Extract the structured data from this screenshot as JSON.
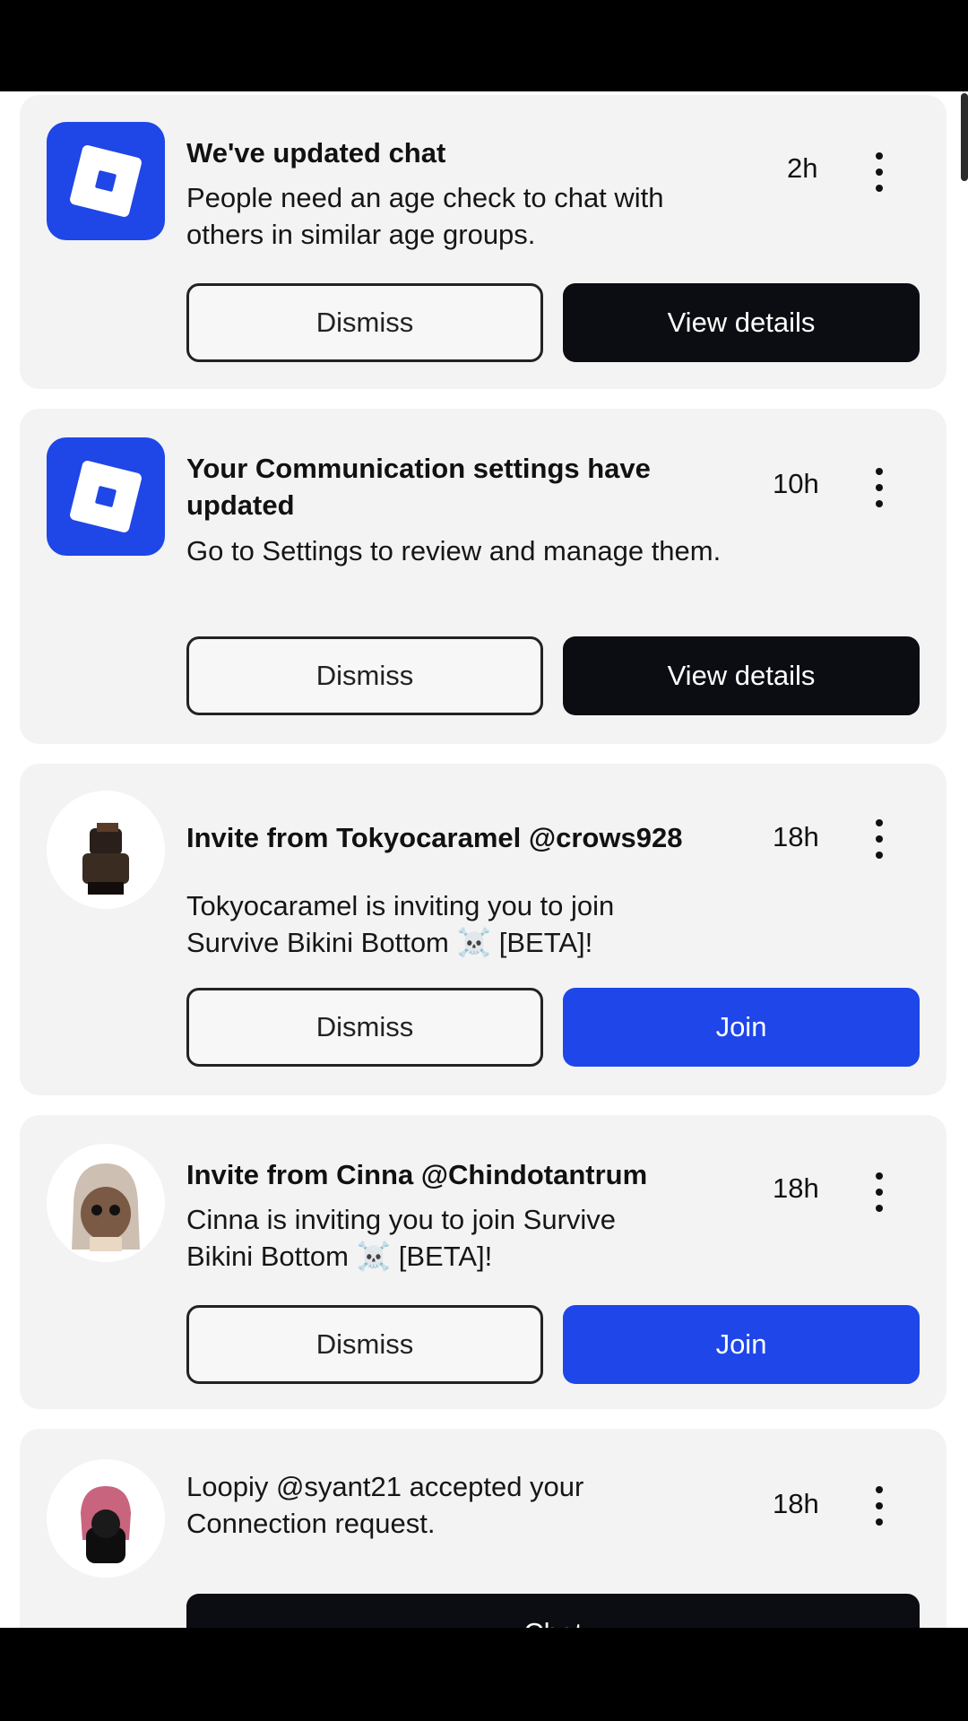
{
  "notifications": [
    {
      "title": "We've updated chat",
      "body": "People need an age check to chat with others in similar age groups.",
      "time": "2h",
      "avatar": "roblox-logo-icon",
      "dismiss_label": "Dismiss",
      "action_label": "View details"
    },
    {
      "title": "Your Communication settings have updated",
      "body": "Go to Settings to review and manage them.",
      "time": "10h",
      "avatar": "roblox-logo-icon",
      "dismiss_label": "Dismiss",
      "action_label": "View details"
    },
    {
      "title": "Invite from Tokyocaramel @crows928",
      "body_line1": "Tokyocaramel is inviting you to join",
      "body_line2_before": "Survive Bikini Bottom",
      "body_line2_after": "[BETA]!",
      "skull": "☠️",
      "time": "18h",
      "avatar": "user-avatar-dark",
      "dismiss_label": "Dismiss",
      "action_label": "Join"
    },
    {
      "title": "Invite from Cinna @Chindotantrum",
      "body_line1": "Cinna is inviting you to join Survive",
      "body_line2_before": "Bikini Bottom",
      "body_line2_after": "[BETA]!",
      "skull": "☠️",
      "time": "18h",
      "avatar": "user-avatar-blonde",
      "dismiss_label": "Dismiss",
      "action_label": "Join"
    },
    {
      "body": "Loopiy @syant21 accepted your Connection request.",
      "time": "18h",
      "avatar": "user-avatar-pink",
      "action_label": "Chat"
    }
  ],
  "colors": {
    "brand_blue": "#1e46e9",
    "dark_button": "#0b0d12",
    "card_bg": "#f3f3f4"
  }
}
